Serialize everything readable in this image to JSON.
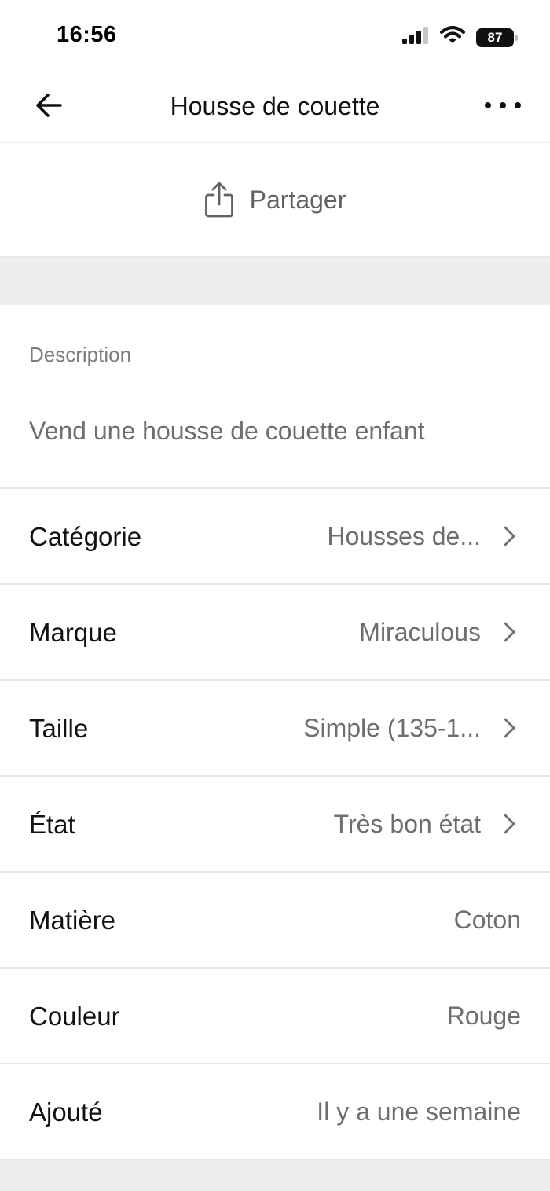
{
  "status_bar": {
    "time": "16:56",
    "battery": "87",
    "icons": [
      "cellular-signal-icon",
      "wifi-icon",
      "battery-icon"
    ]
  },
  "nav": {
    "title": "Housse de couette",
    "back_icon": "arrow-left-icon",
    "more_icon": "more-horizontal-icon"
  },
  "share": {
    "label": "Partager",
    "icon": "share-icon"
  },
  "description": {
    "heading": "Description",
    "text": "Vend une housse de couette enfant"
  },
  "attributes": [
    {
      "label": "Catégorie",
      "value": "Housses de...",
      "has_chevron": true
    },
    {
      "label": "Marque",
      "value": "Miraculous",
      "has_chevron": true
    },
    {
      "label": "Taille",
      "value": "Simple (135-1...",
      "has_chevron": true
    },
    {
      "label": "État",
      "value": "Très bon état",
      "has_chevron": true
    },
    {
      "label": "Matière",
      "value": "Coton",
      "has_chevron": false
    },
    {
      "label": "Couleur",
      "value": "Rouge",
      "has_chevron": false
    },
    {
      "label": "Ajouté",
      "value": "Il y a une semaine",
      "has_chevron": false
    }
  ],
  "colors": {
    "primary_text": "#111111",
    "secondary_text": "#6b6f72",
    "divider": "#e6e6e6",
    "band": "#eceeef"
  }
}
